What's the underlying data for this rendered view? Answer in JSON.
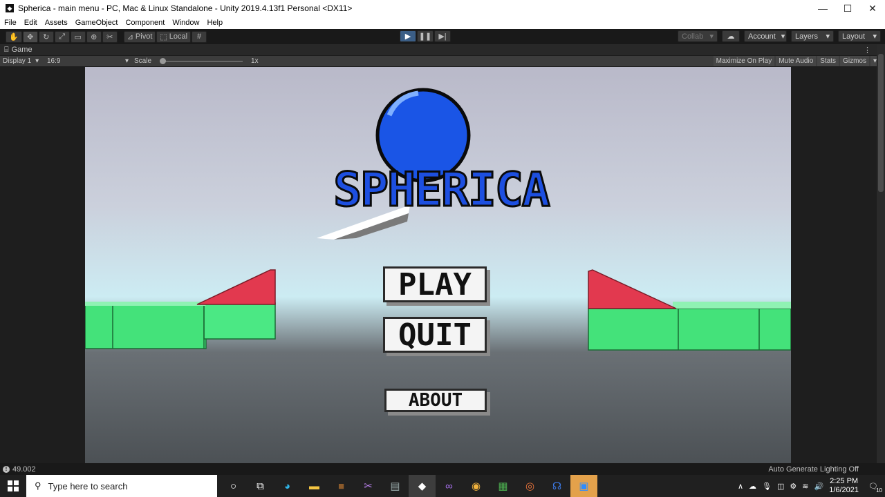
{
  "window": {
    "title": "Spherica - main menu - PC, Mac & Linux Standalone - Unity 2019.4.13f1 Personal <DX11>",
    "controls": [
      "—",
      "☐",
      "✕"
    ]
  },
  "menubar": {
    "items": [
      "File",
      "Edit",
      "Assets",
      "GameObject",
      "Component",
      "Window",
      "Help"
    ]
  },
  "toolbar": {
    "pivot": "Pivot",
    "local": "Local",
    "collab": "Collab",
    "account": "Account",
    "layers": "Layers",
    "layout": "Layout"
  },
  "game_tab": {
    "label": "Game"
  },
  "game_bar": {
    "display": "Display 1",
    "aspect": "16:9",
    "scale_label": "Scale",
    "scale_value": "1x",
    "maximize": "Maximize On Play",
    "mute": "Mute Audio",
    "stats": "Stats",
    "gizmos": "Gizmos"
  },
  "game": {
    "logo_text": "SPHERICA",
    "buttons": {
      "play": "PLAY",
      "quit": "QUIT",
      "about": "ABOUT"
    },
    "colors": {
      "ball": "#1a55e6",
      "block_green": "#44e27a",
      "ramp_red": "#e2394f"
    }
  },
  "statusbar": {
    "value": "49.002",
    "lighting": "Auto Generate Lighting Off"
  },
  "taskbar": {
    "search_placeholder": "Type here to search",
    "time": "2:25 PM",
    "date": "1/6/2021",
    "notifications": "10"
  }
}
